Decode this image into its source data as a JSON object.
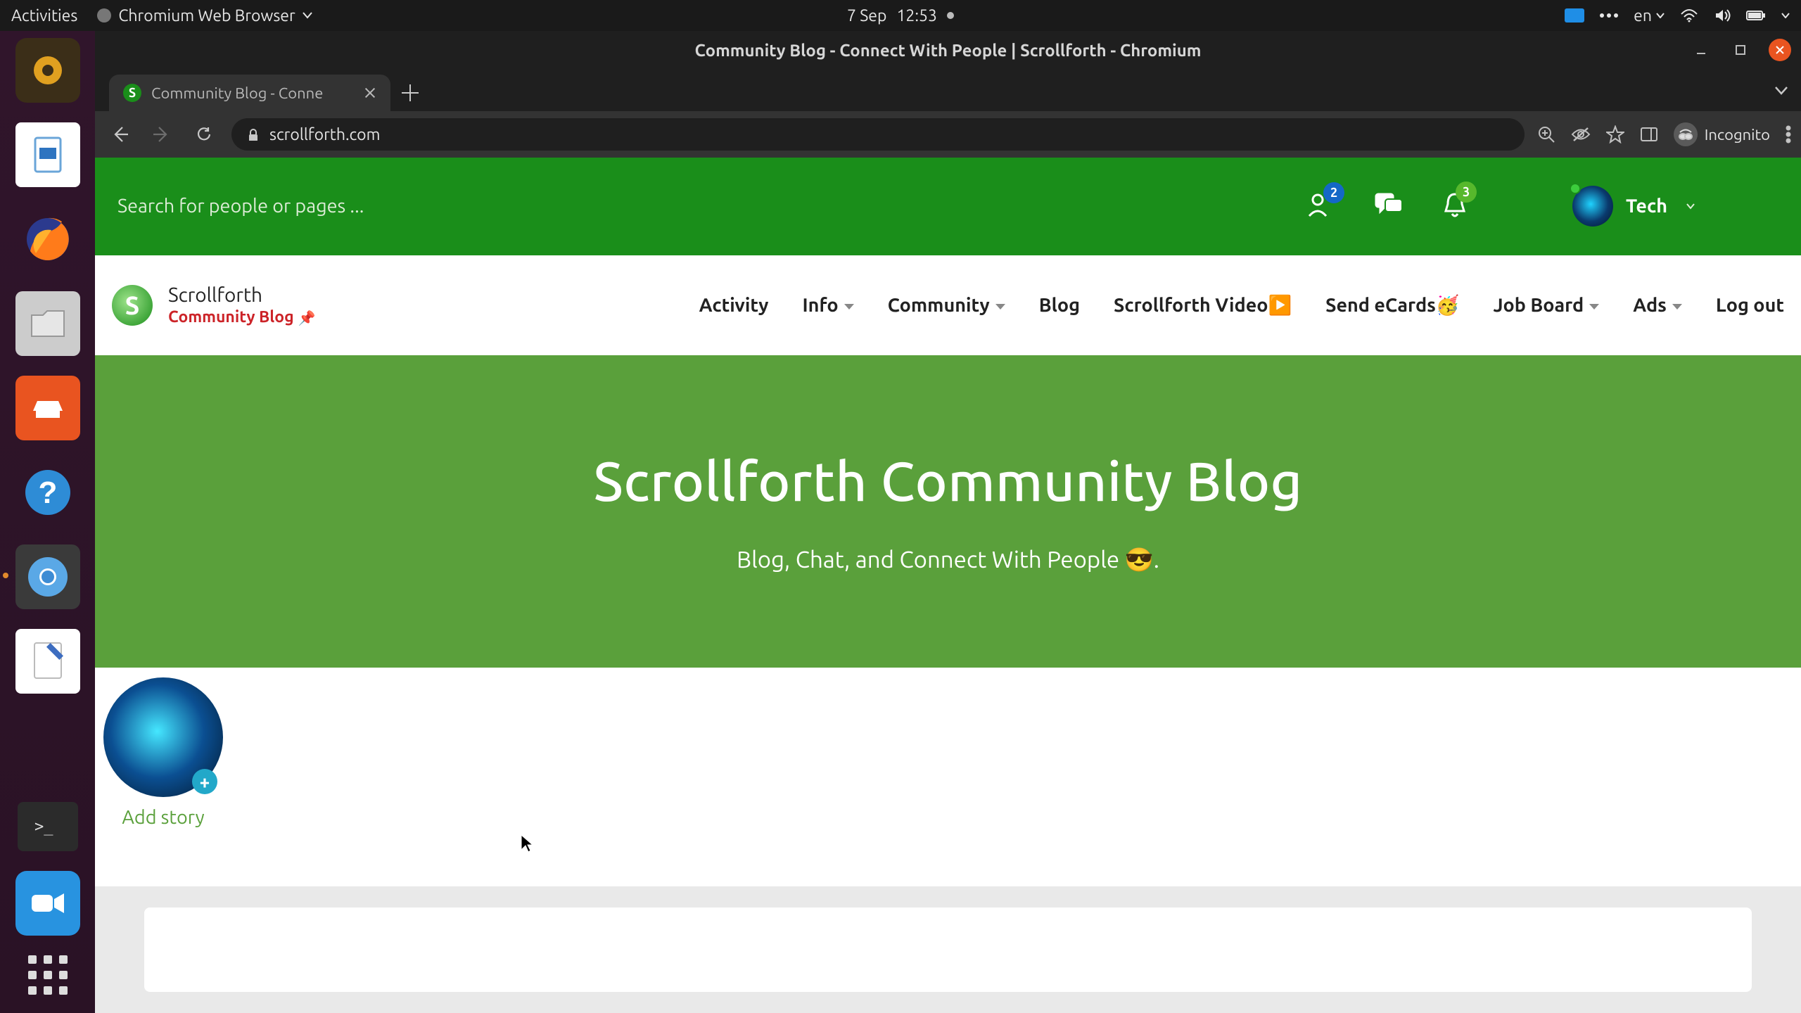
{
  "topbar": {
    "activities": "Activities",
    "app_label": "Chromium Web Browser",
    "date": "7 Sep",
    "time": "12:53",
    "lang": "en"
  },
  "dock": {
    "items": [
      "rhythmbox-icon",
      "libreoffice-writer-icon",
      "firefox-icon",
      "files-icon",
      "software-icon",
      "help-icon",
      "chromium-icon",
      "text-editor-icon",
      "terminal-icon",
      "zoom-icon"
    ],
    "active_index": 6
  },
  "chrome": {
    "window_title": "Community Blog - Connect With People | Scrollforth - Chromium",
    "tab_title": "Community Blog - Conne",
    "url": "scrollforth.com",
    "incognito_label": "Incognito"
  },
  "site": {
    "search_placeholder": "Search for people or pages ...",
    "badges": {
      "friends": "2",
      "notifications": "3"
    },
    "user_name": "Tech",
    "brand": {
      "name": "Scrollforth",
      "subtitle": "Community Blog"
    },
    "nav": {
      "activity": "Activity",
      "info": "Info",
      "community": "Community",
      "blog": "Blog",
      "video": "Scrollforth Video▶️",
      "ecards": "Send eCards🥳",
      "jobs": "Job Board",
      "ads": "Ads",
      "logout": "Log out"
    },
    "hero": {
      "title": "Scrollforth Community Blog",
      "tagline": "Blog, Chat, and Connect With People 😎."
    },
    "story_label": "Add story"
  }
}
